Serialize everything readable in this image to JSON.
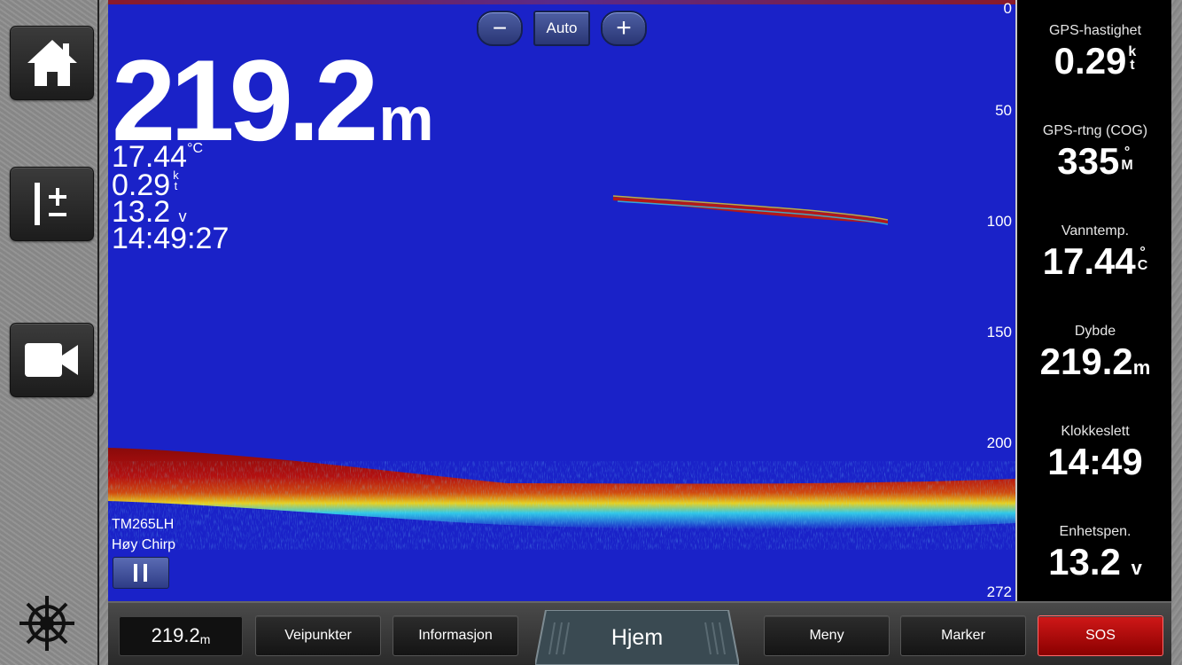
{
  "sidebar": {
    "home_icon": "home-icon",
    "adjust_icon": "gain-adjust-icon",
    "video_icon": "video-camera-icon",
    "helm_icon": "ship-wheel-icon"
  },
  "sonar": {
    "zoom_out_label": "−",
    "auto_label": "Auto",
    "zoom_in_label": "+",
    "depth_value": "219.2",
    "depth_unit": "m",
    "water_temp": "17.44",
    "water_temp_unit": "°C",
    "speed": "0.29",
    "speed_unit_top": "k",
    "speed_unit_bottom": "t",
    "voltage": "13.2",
    "voltage_unit": "v",
    "time": "14:49:27",
    "transducer": "TM265LH",
    "frequency": "Høy Chirp",
    "depth_scale": [
      "0",
      "50",
      "100",
      "150",
      "200",
      "272"
    ],
    "colors": {
      "water": "#1a22c8",
      "bottom": "#a01010"
    }
  },
  "data_fields": [
    {
      "label": "GPS-hastighet",
      "value": "0.29",
      "unit_top": "k",
      "unit_bottom": "t"
    },
    {
      "label": "GPS-rtng (COG)",
      "value": "335",
      "unit_top": "°",
      "unit_bottom": "M"
    },
    {
      "label": "Vanntemp.",
      "value": "17.44",
      "unit_top": "°",
      "unit_bottom": "C"
    },
    {
      "label": "Dybde",
      "value": "219.2",
      "unit": "m"
    },
    {
      "label": "Klokkeslett",
      "value": "14:49",
      "unit": ""
    },
    {
      "label": "Enhetspen.",
      "value": "13.2",
      "unit": "v"
    }
  ],
  "bottom_bar": {
    "depth_value": "219.2",
    "depth_unit": "m",
    "waypoints": "Veipunkter",
    "information": "Informasjon",
    "home": "Hjem",
    "menu": "Meny",
    "mark": "Marker",
    "sos": "SOS"
  }
}
